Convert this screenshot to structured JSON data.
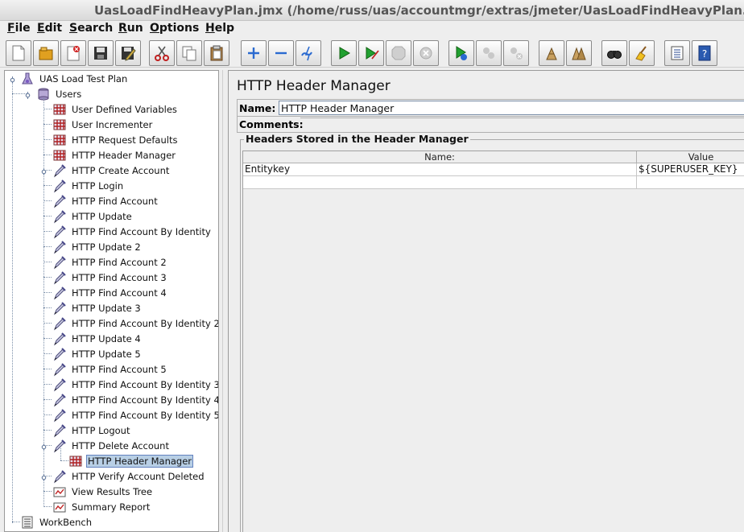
{
  "window": {
    "title": "UasLoadFindHeavyPlan.jmx (/home/russ/uas/accountmgr/extras/jmeter/UasLoadFindHeavyPlan.jmx) - Apache JMeter"
  },
  "menu": [
    {
      "mnemonic": "F",
      "rest": "ile"
    },
    {
      "mnemonic": "E",
      "rest": "dit"
    },
    {
      "mnemonic": "S",
      "rest": "earch"
    },
    {
      "mnemonic": "R",
      "rest": "un"
    },
    {
      "mnemonic": "O",
      "rest": "ptions"
    },
    {
      "mnemonic": "H",
      "rest": "elp"
    }
  ],
  "toolbar": [
    {
      "name": "new-icon"
    },
    {
      "name": "open-icon"
    },
    {
      "name": "close-icon"
    },
    {
      "name": "save-icon"
    },
    {
      "name": "save-as-icon"
    },
    {
      "name": "cut-icon"
    },
    {
      "name": "copy-icon"
    },
    {
      "name": "paste-icon"
    },
    {
      "name": "expand-icon"
    },
    {
      "name": "collapse-icon"
    },
    {
      "name": "toggle-icon"
    },
    {
      "name": "start-icon"
    },
    {
      "name": "start-no-pause-icon"
    },
    {
      "name": "stop-icon"
    },
    {
      "name": "shutdown-icon"
    },
    {
      "name": "remote-start-icon"
    },
    {
      "name": "remote-stop-icon"
    },
    {
      "name": "remote-shutdown-icon"
    },
    {
      "name": "clear-icon"
    },
    {
      "name": "clear-all-icon"
    },
    {
      "name": "search-icon"
    },
    {
      "name": "reset-search-icon"
    },
    {
      "name": "function-helper-icon"
    },
    {
      "name": "help-icon"
    }
  ],
  "tree": {
    "plan": "UAS Load Test Plan",
    "users": "Users",
    "children": [
      {
        "label": "User Defined Variables",
        "icon": "config-icon"
      },
      {
        "label": "User Incrementer",
        "icon": "config-icon"
      },
      {
        "label": "HTTP Request Defaults",
        "icon": "config-icon"
      },
      {
        "label": "HTTP Header Manager",
        "icon": "config-icon"
      },
      {
        "label": "HTTP Create Account",
        "icon": "sampler-icon",
        "handle": true
      },
      {
        "label": "HTTP Login",
        "icon": "sampler-icon"
      },
      {
        "label": "HTTP Find Account",
        "icon": "sampler-icon"
      },
      {
        "label": "HTTP Update",
        "icon": "sampler-icon"
      },
      {
        "label": "HTTP Find Account By Identity",
        "icon": "sampler-icon"
      },
      {
        "label": "HTTP Update 2",
        "icon": "sampler-icon"
      },
      {
        "label": "HTTP Find Account 2",
        "icon": "sampler-icon"
      },
      {
        "label": "HTTP Find Account 3",
        "icon": "sampler-icon"
      },
      {
        "label": "HTTP Find Account 4",
        "icon": "sampler-icon"
      },
      {
        "label": "HTTP Update 3",
        "icon": "sampler-icon"
      },
      {
        "label": "HTTP Find Account By Identity 2",
        "icon": "sampler-icon"
      },
      {
        "label": "HTTP Update 4",
        "icon": "sampler-icon"
      },
      {
        "label": "HTTP Update 5",
        "icon": "sampler-icon"
      },
      {
        "label": "HTTP Find Account 5",
        "icon": "sampler-icon"
      },
      {
        "label": "HTTP Find Account By Identity 3",
        "icon": "sampler-icon"
      },
      {
        "label": "HTTP Find Account By Identity 4",
        "icon": "sampler-icon"
      },
      {
        "label": "HTTP Find Account By Identity 5",
        "icon": "sampler-icon"
      },
      {
        "label": "HTTP Logout",
        "icon": "sampler-icon"
      },
      {
        "label": "HTTP Delete Account",
        "icon": "sampler-icon",
        "handle": true
      },
      {
        "label": "HTTP Header Manager",
        "icon": "config-icon",
        "sub": true,
        "selected": true
      },
      {
        "label": "HTTP Verify Account Deleted",
        "icon": "sampler-icon",
        "handle": true
      },
      {
        "label": "View Results Tree",
        "icon": "listener-icon"
      },
      {
        "label": "Summary Report",
        "icon": "listener-icon"
      }
    ],
    "workbench": "WorkBench"
  },
  "editor": {
    "title": "HTTP Header Manager",
    "name_label": "Name:",
    "name_value": "HTTP Header Manager",
    "comments_label": "Comments:",
    "group_title": "Headers Stored in the Header Manager",
    "columns": [
      "Name:",
      "Value"
    ],
    "rows": [
      [
        "Entitykey",
        "${SUPERUSER_KEY}"
      ],
      [
        "",
        ""
      ]
    ]
  }
}
